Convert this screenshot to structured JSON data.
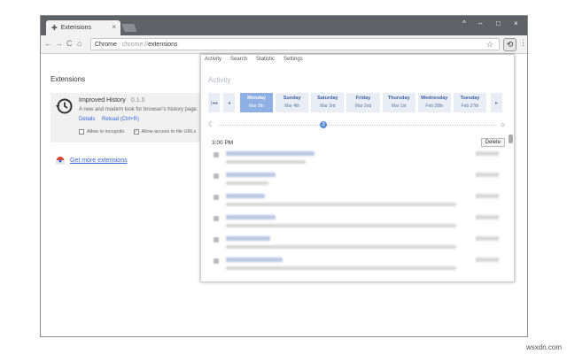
{
  "browser": {
    "tab_title": "Extensions",
    "tab_close": "×",
    "window_controls": [
      "^",
      "–",
      "□",
      "×"
    ],
    "nav": {
      "back": "←",
      "forward": "→",
      "reload": "C",
      "home": "⌂"
    },
    "omnibox": {
      "secure_label": "Chrome",
      "url_scheme": "chrome://",
      "url_path": "extensions"
    },
    "menu": "⋮"
  },
  "extensions_page": {
    "title": "Extensions",
    "extension": {
      "name": "Improved History",
      "version": "0.1.0",
      "description": "A new and modern look for browser's history page.",
      "links": [
        "Details",
        "Reload (Ctrl+R)"
      ],
      "options": [
        {
          "label": "Allow in incognito",
          "checked": false
        },
        {
          "label": "Allow access to file URLs",
          "checked": true
        }
      ]
    },
    "get_more": "Get more extensions"
  },
  "popup": {
    "tabs": [
      "Activity",
      "Search",
      "Statistic",
      "Settings"
    ],
    "title": "Activity",
    "arrows": {
      "first": "|◂◂",
      "prev": "◂",
      "next": "▸"
    },
    "days": [
      {
        "name": "Monday",
        "date": "Mar 5th",
        "active": true
      },
      {
        "name": "Sunday",
        "date": "Mar 4th",
        "active": false
      },
      {
        "name": "Saturday",
        "date": "Mar 3rd",
        "active": false
      },
      {
        "name": "Friday",
        "date": "Mar 2nd",
        "active": false
      },
      {
        "name": "Thursday",
        "date": "Mar 1st",
        "active": false
      },
      {
        "name": "Wednesday",
        "date": "Feb 28th",
        "active": false
      },
      {
        "name": "Tuesday",
        "date": "Feb 27th",
        "active": false
      }
    ],
    "timeline_hour": "3",
    "time_label": "3:00 PM",
    "delete_label": "Delete"
  },
  "watermark": "wsxdn.com"
}
